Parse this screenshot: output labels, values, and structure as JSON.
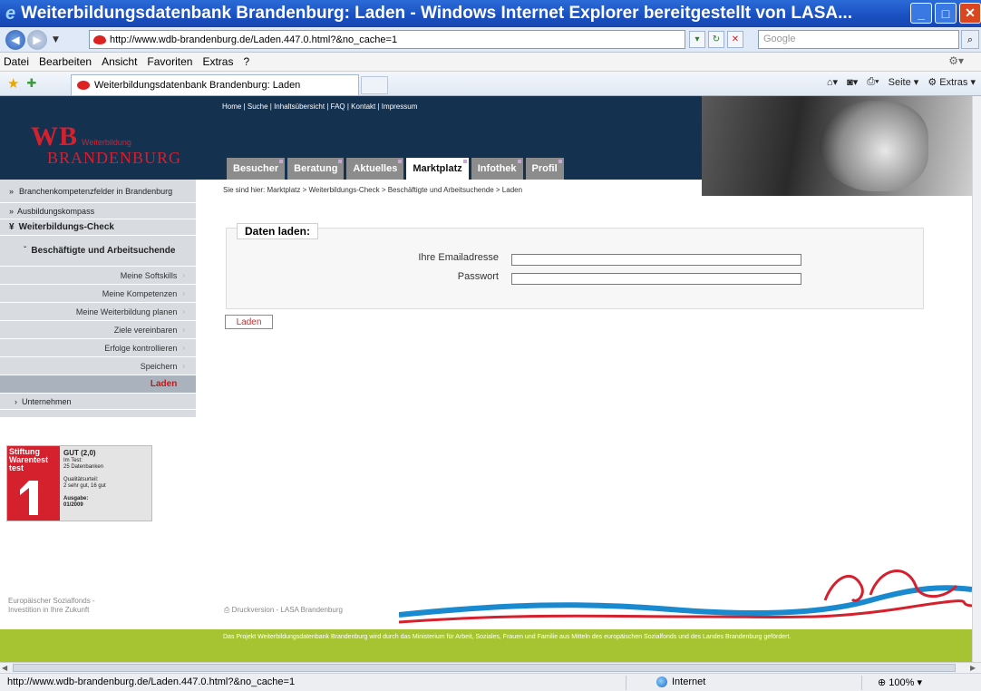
{
  "window": {
    "title": "Weiterbildungsdatenbank Brandenburg: Laden - Windows Internet Explorer bereitgestellt von LASA..."
  },
  "address_bar": {
    "url": "http://www.wdb-brandenburg.de/Laden.447.0.html?&no_cache=1",
    "search_placeholder": "Google"
  },
  "menu": [
    "Datei",
    "Bearbeiten",
    "Ansicht",
    "Favoriten",
    "Extras",
    "?"
  ],
  "tab": {
    "title": "Weiterbildungsdatenbank Brandenburg: Laden"
  },
  "command_bar": {
    "page_label": "Seite",
    "tools_label": "Extras"
  },
  "site": {
    "logo_wb": "WB",
    "logo_sub": "Weiterbildung",
    "logo_brand": "BRANDENBURG",
    "toplinks": "Home | Suche | Inhaltsübersicht | FAQ | Kontakt | Impressum",
    "nav_tabs": [
      {
        "label": "Besucher"
      },
      {
        "label": "Beratung"
      },
      {
        "label": "Aktuelles"
      },
      {
        "label": "Marktplatz"
      },
      {
        "label": "Infothek"
      },
      {
        "label": "Profil"
      }
    ],
    "breadcrumb": "Sie sind hier: Marktplatz > Weiterbildungs-Check > Beschäftigte und Arbeitsuchende > Laden"
  },
  "sidebar": {
    "item1": "Branchenkompetenzfelder in Brandenburg",
    "item2": "Ausbildungskompass",
    "item3": "Weiterbildungs-Check",
    "item4": "Beschäftigte und Arbeitsuchende",
    "sub_items": [
      {
        "label": "Meine Softskills"
      },
      {
        "label": "Meine Kompetenzen"
      },
      {
        "label": "Meine Weiterbildung planen"
      },
      {
        "label": "Ziele vereinbaren"
      },
      {
        "label": "Erfolge kontrollieren"
      },
      {
        "label": "Speichern"
      },
      {
        "label": "Laden"
      }
    ],
    "item5": "Unternehmen"
  },
  "form": {
    "legend": "Daten laden:",
    "email_label": "Ihre Emailadresse",
    "password_label": "Passwort",
    "email_value": "",
    "password_value": "",
    "submit_label": "Laden"
  },
  "stiftung": {
    "logo_line1": "Stiftung",
    "logo_line2": "Warentest",
    "logo_line3": "test",
    "grade": "GUT (2,0)",
    "line1": "Im Test:",
    "line2": "25 Datenbanken",
    "line3": "Qualitätsurteil:",
    "line4": "2 sehr gut, 16 gut",
    "line5": "Ausgabe:",
    "line6": "01/2009"
  },
  "footer": {
    "esf_line1": "Europäischer Sozialfonds -",
    "esf_line2": "Investition in Ihre Zukunft",
    "print": "Druckversion - LASA Brandenburg",
    "funding_text": "Das Projekt Weiterbildungsdatenbank Brandenburg wird durch das Ministerium für Arbeit, Soziales, Frauen und Familie aus Mitteln des europäischen Sozialfonds und des Landes Brandenburg gefördert."
  },
  "status_bar": {
    "url": "http://www.wdb-brandenburg.de/Laden.447.0.html?&no_cache=1",
    "zone": "Internet",
    "zoom": "100%"
  },
  "colors": {
    "brand_red": "#d5202e",
    "header_navy": "#143150",
    "footer_green": "#a6c431",
    "sidebar_gray": "#d8dce1"
  }
}
